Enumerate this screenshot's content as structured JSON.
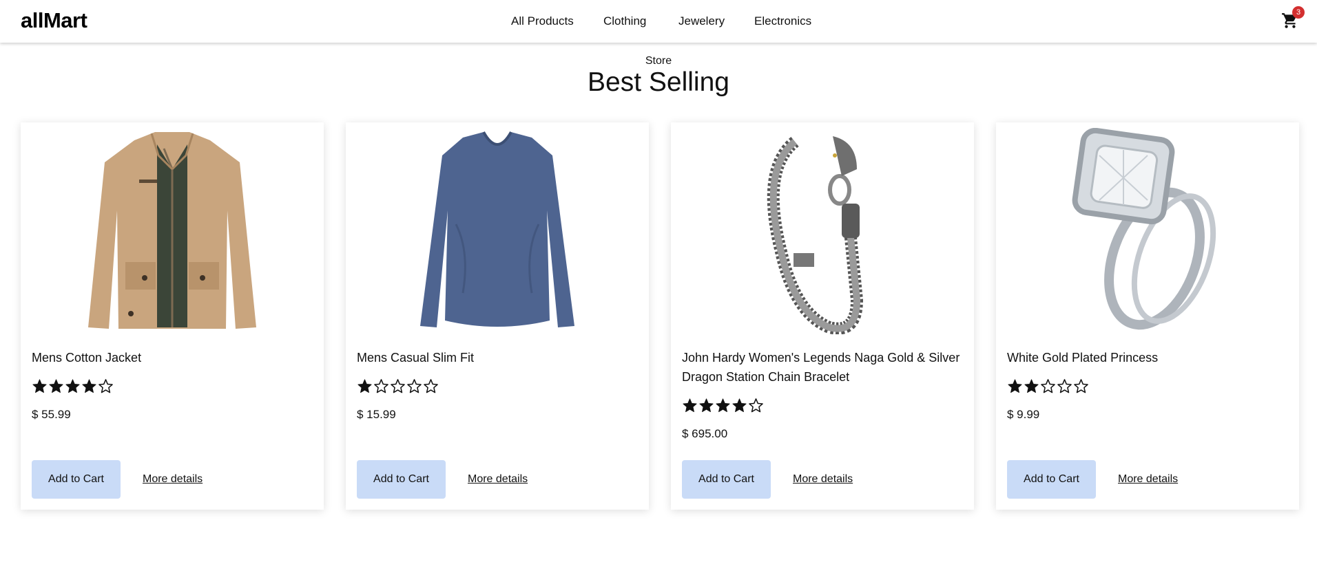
{
  "navbar": {
    "brand": "allMart",
    "links": [
      "All Products",
      "Clothing",
      "Jewelery",
      "Electronics"
    ],
    "cart_icon": "shopping-cart-icon",
    "cart_count": "3"
  },
  "section": {
    "subtitle": "Store",
    "title": "Best Selling"
  },
  "products": [
    {
      "title": "Mens Cotton Jacket",
      "rating": 4,
      "price": "$ 55.99",
      "image": "jacket-image",
      "add_label": "Add to Cart",
      "details_label": "More details"
    },
    {
      "title": "Mens Casual Slim Fit",
      "rating": 1,
      "price": "$ 15.99",
      "image": "tshirt-image",
      "add_label": "Add to Cart",
      "details_label": "More details"
    },
    {
      "title": "John Hardy Women's Legends Naga Gold & Silver Dragon Station Chain Bracelet",
      "rating": 4,
      "price": "$ 695.00",
      "image": "bracelet-image",
      "add_label": "Add to Cart",
      "details_label": "More details"
    },
    {
      "title": "White Gold Plated Princess",
      "rating": 2,
      "price": "$ 9.99",
      "image": "ring-image",
      "add_label": "Add to Cart",
      "details_label": "More details"
    }
  ],
  "colors": {
    "button_bg": "#c9dbf7",
    "badge": "#d32f2f"
  }
}
